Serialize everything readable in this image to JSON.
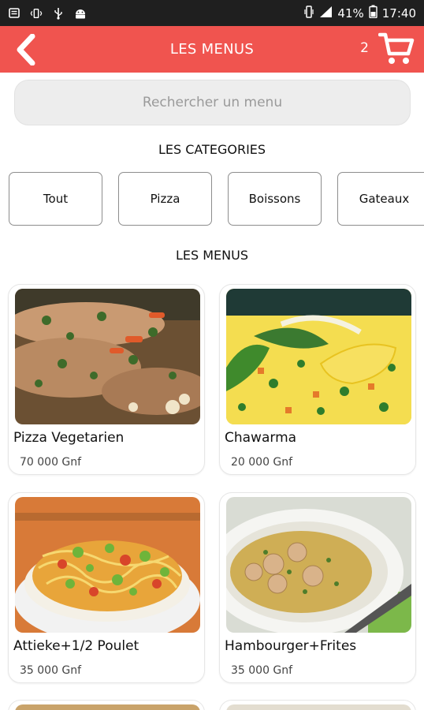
{
  "status_bar": {
    "battery": "41%",
    "time": "17:40"
  },
  "header": {
    "title": "LES MENUS",
    "cart_count": "2",
    "background": "#f0544f"
  },
  "search": {
    "placeholder": "Rechercher un menu"
  },
  "categories": {
    "title": "LES CATEGORIES",
    "items": [
      "Tout",
      "Pizza",
      "Boissons",
      "Gateaux"
    ]
  },
  "menus": {
    "title": "LES MENUS",
    "items": [
      {
        "name": "Pizza Vegetarien",
        "price": "70 000 Gnf"
      },
      {
        "name": "Chawarma",
        "price": "20 000 Gnf"
      },
      {
        "name": "Attieke+1/2 Poulet",
        "price": "35 000 Gnf"
      },
      {
        "name": "Hambourger+Frites",
        "price": "35 000 Gnf"
      }
    ]
  }
}
